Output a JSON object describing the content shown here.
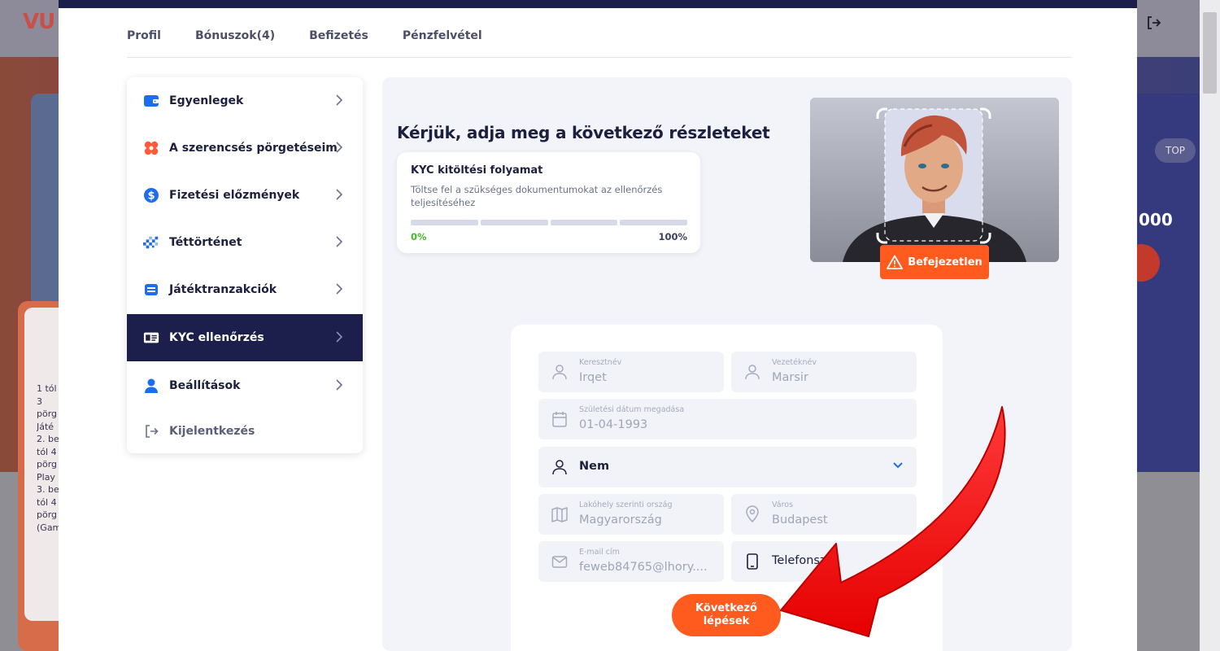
{
  "background": {
    "logo": "VU",
    "top_pill": "TOP",
    "num_fragment": "000",
    "left_text": "1 tól 3 pörg Játé 2. be tól 4 pörg Play 3. be tól 4 pörg (Gam"
  },
  "tabs": [
    {
      "label": "Profil"
    },
    {
      "label": "Bónuszok(4)"
    },
    {
      "label": "Befizetés"
    },
    {
      "label": "Pénzfelvétel"
    }
  ],
  "menu": {
    "items": [
      {
        "label": "Egyenlegek",
        "icon": "wallet-icon"
      },
      {
        "label": "A szerencsés pörgetéseim",
        "icon": "clover-icon"
      },
      {
        "label": "Fizetési előzmények",
        "icon": "dollar-icon"
      },
      {
        "label": "Téttörténet",
        "icon": "checker-flag-icon"
      },
      {
        "label": "Játéktranzakciók",
        "icon": "game-card-icon"
      },
      {
        "label": "KYC ellenőrzés",
        "icon": "id-card-icon"
      },
      {
        "label": "Beállítások",
        "icon": "user-icon"
      }
    ],
    "logout_label": "Kijelentkezés"
  },
  "kyc": {
    "title": "Kérjük, adja meg a következő részleteket",
    "progress": {
      "title": "KYC kitöltési folyamat",
      "description": "Töltse fel a szükséges dokumentumokat az ellenőrzés teljesítéséhez",
      "value_percent": 0,
      "start_label": "0%",
      "end_label": "100%"
    },
    "badge": "Befejezetlen"
  },
  "form": {
    "first_name": {
      "label": "Keresztnév",
      "value": "Irqet"
    },
    "last_name": {
      "label": "Vezetéknév",
      "value": "Marsir"
    },
    "birth_date": {
      "label": "Születési dátum megadása",
      "value": "01-04-1993"
    },
    "gender": {
      "value": "Nem"
    },
    "country": {
      "label": "Lakóhely szerinti ország",
      "value": "Magyarország"
    },
    "city": {
      "label": "Város",
      "value": "Budapest"
    },
    "email": {
      "label": "E-mail cím",
      "value": "feweb84765@lhory...."
    },
    "phone": {
      "value": "Telefonsz"
    },
    "next_button": "Következő lépések"
  },
  "colors": {
    "accent": "#ff5b1e",
    "navy": "#1c1f4b",
    "progress_green": "#48b628",
    "arrow_red": "#ff1a1a"
  }
}
